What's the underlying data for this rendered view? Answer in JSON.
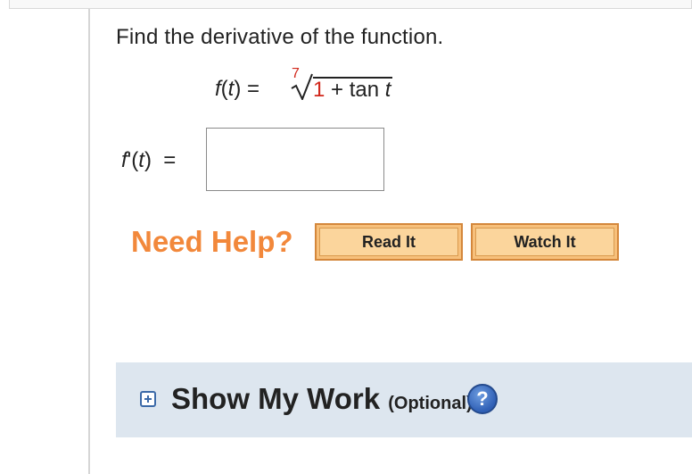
{
  "question": {
    "prompt": "Find the derivative of the function.",
    "equation": {
      "lhs_name": "f",
      "lhs_var": "t",
      "equals": "=",
      "root_index": "7",
      "radicand_number": "1",
      "radicand_plus": "+",
      "radicand_func": "tan",
      "radicand_var": "t"
    }
  },
  "answer": {
    "label_name": "f",
    "label_prime": "'",
    "label_var": "t",
    "equals": "=",
    "value": ""
  },
  "help": {
    "title": "Need Help?",
    "read_it": "Read It",
    "watch_it": "Watch It"
  },
  "work": {
    "title": "Show My Work",
    "optional": "(Optional)",
    "help_icon": "?"
  },
  "icons": {
    "expand": "plus-box-icon",
    "help": "question-circle-icon"
  },
  "colors": {
    "accent_orange": "#f2883b",
    "button_fill": "#fbd59c",
    "highlight_red": "#d1271b",
    "panel_bg": "#dde6ef",
    "link_blue": "#3c6aa8"
  }
}
